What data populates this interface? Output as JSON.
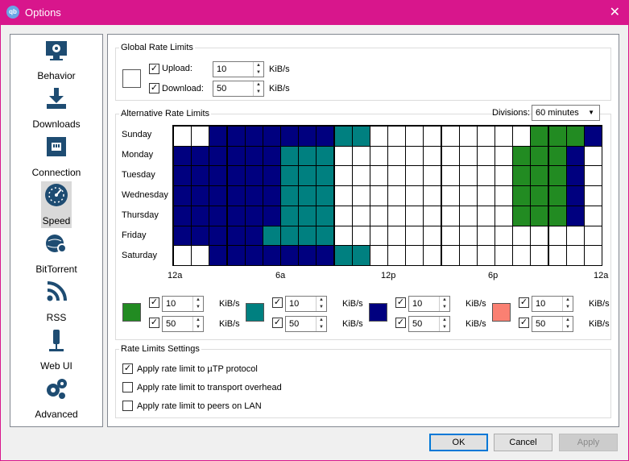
{
  "window": {
    "title": "Options",
    "app_badge": "qb",
    "close_glyph": "✕"
  },
  "sidebar": {
    "items": [
      {
        "label": "Behavior",
        "icon": "monitor-gear-icon"
      },
      {
        "label": "Downloads",
        "icon": "download-icon"
      },
      {
        "label": "Connection",
        "icon": "network-icon"
      },
      {
        "label": "Speed",
        "icon": "speedometer-icon",
        "selected": true
      },
      {
        "label": "BitTorrent",
        "icon": "globe-gear-icon"
      },
      {
        "label": "RSS",
        "icon": "rss-icon"
      },
      {
        "label": "Web UI",
        "icon": "web-ui-icon"
      },
      {
        "label": "Advanced",
        "icon": "gears-icon"
      }
    ]
  },
  "global": {
    "title": "Global Rate Limits",
    "upload_label": "Upload:",
    "upload_value": "10",
    "download_label": "Download:",
    "download_value": "50",
    "unit": "KiB/s"
  },
  "alternative": {
    "title": "Alternative Rate Limits",
    "divisions_label": "Divisions:",
    "divisions_value": "60 minutes",
    "days": [
      "Sunday",
      "Monday",
      "Tuesday",
      "Wednesday",
      "Thursday",
      "Friday",
      "Saturday"
    ],
    "hour_labels": [
      "12a",
      "6a",
      "12p",
      "6p",
      "12a"
    ],
    "schedule": [
      "wwbbbbbbbtt wwwwwwwwwgggb",
      "bbbbbbtttwwwwwwwwwwgggb",
      "bbbbbbtttwwwwwwwwwwgggb",
      "bbbbbbtttwwwwwwwwwwgggb",
      "bbbbbbtttwwwwwwwwwwgggb",
      "bbbbbttttwwwwwwwwwwwwww",
      "wwbbbbbbbttwwwwwwwwwwwww"
    ],
    "colors": {
      "w": "#ffffff",
      "b": "#00007f",
      "t": "#008080",
      "g": "#228b22"
    },
    "limits": [
      {
        "color": "#228b22",
        "upload": "10",
        "download": "50"
      },
      {
        "color": "#008080",
        "upload": "10",
        "download": "50"
      },
      {
        "color": "#00007f",
        "upload": "10",
        "download": "50"
      },
      {
        "color": "#fa8072",
        "upload": "10",
        "download": "50"
      }
    ],
    "unit": "KiB/s"
  },
  "settings": {
    "title": "Rate Limits Settings",
    "options": [
      {
        "label": "Apply rate limit to µTP protocol",
        "checked": true
      },
      {
        "label": "Apply rate limit to transport overhead",
        "checked": false
      },
      {
        "label": "Apply rate limit to peers on LAN",
        "checked": false
      }
    ]
  },
  "buttons": {
    "ok": "OK",
    "cancel": "Cancel",
    "apply": "Apply"
  },
  "check_glyph": "✓"
}
